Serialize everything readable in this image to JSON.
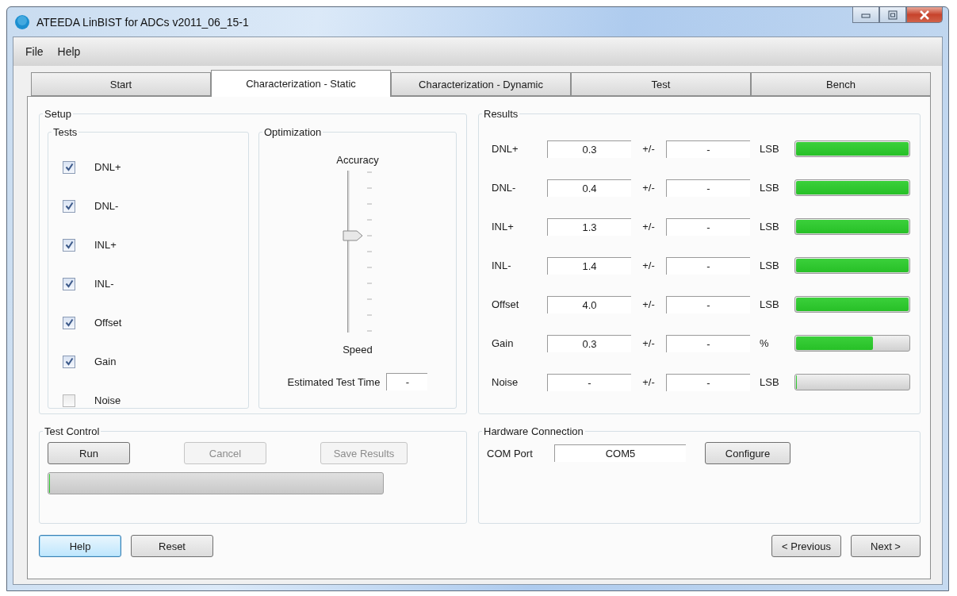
{
  "window": {
    "title": "ATEEDA LinBIST for ADCs v2011_06_15-1"
  },
  "menu": [
    "File",
    "Help"
  ],
  "tabs": [
    {
      "label": "Start",
      "selected": false
    },
    {
      "label": "Characterization - Static",
      "selected": true
    },
    {
      "label": "Characterization - Dynamic",
      "selected": false
    },
    {
      "label": "Test",
      "selected": false
    },
    {
      "label": "Bench",
      "selected": false
    }
  ],
  "setup": {
    "title": "Setup",
    "tests": {
      "title": "Tests",
      "items": [
        {
          "label": "DNL+",
          "checked": true
        },
        {
          "label": "DNL-",
          "checked": true
        },
        {
          "label": "INL+",
          "checked": true
        },
        {
          "label": "INL-",
          "checked": true
        },
        {
          "label": "Offset",
          "checked": true
        },
        {
          "label": "Gain",
          "checked": true
        },
        {
          "label": "Noise",
          "checked": false
        }
      ]
    },
    "optimization": {
      "title": "Optimization",
      "top_label": "Accuracy",
      "bottom_label": "Speed",
      "level": 0.6,
      "estimate_label": "Estimated Test Time",
      "estimate_value": "-"
    }
  },
  "results": {
    "title": "Results",
    "rows": [
      {
        "label": "DNL+",
        "value": "0.3",
        "pm": "+/-",
        "error": "-",
        "unit": "LSB",
        "level": 1
      },
      {
        "label": "DNL-",
        "value": "0.4",
        "pm": "+/-",
        "error": "-",
        "unit": "LSB",
        "level": 1
      },
      {
        "label": "INL+",
        "value": "1.3",
        "pm": "+/-",
        "error": "-",
        "unit": "LSB",
        "level": 1
      },
      {
        "label": "INL-",
        "value": "1.4",
        "pm": "+/-",
        "error": "-",
        "unit": "LSB",
        "level": 1
      },
      {
        "label": "Offset",
        "value": "4.0",
        "pm": "+/-",
        "error": "-",
        "unit": "LSB",
        "level": 1
      },
      {
        "label": "Gain",
        "value": "0.3",
        "pm": "+/-",
        "error": "-",
        "unit": "%",
        "level": 0.68
      },
      {
        "label": "Noise",
        "value": "-",
        "pm": "+/-",
        "error": "-",
        "unit": "LSB",
        "level": 0
      }
    ]
  },
  "test_control": {
    "title": "Test Control",
    "buttons": [
      {
        "label": "Run",
        "disabled": false
      },
      {
        "label": "Cancel",
        "disabled": true
      },
      {
        "label": "Save Results",
        "disabled": true
      }
    ],
    "progress": {
      "level": 0
    }
  },
  "hardware": {
    "title": "Hardware Connection",
    "port_label": "COM Port",
    "port_value": "COM5",
    "button": "Configure"
  },
  "footer": {
    "left": [
      {
        "label": "Help",
        "focused": true
      },
      {
        "label": "Reset",
        "focused": false
      }
    ],
    "right": [
      {
        "label": "< Previous",
        "focused": false
      },
      {
        "label": "Next >",
        "focused": false
      }
    ]
  }
}
